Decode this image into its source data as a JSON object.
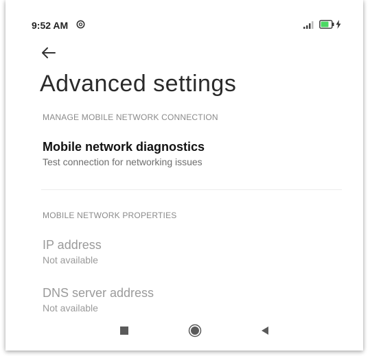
{
  "status_bar": {
    "time": "9:52 AM",
    "icons": [
      "circle-status-icon",
      "signal-icon",
      "battery-icon",
      "charging-bolt-icon"
    ]
  },
  "header": {
    "back_icon": "arrow-left-icon",
    "title": "Advanced settings"
  },
  "sections": [
    {
      "header": "MANAGE MOBILE NETWORK CONNECTION",
      "items": [
        {
          "title": "Mobile network diagnostics",
          "subtitle": "Test connection for networking issues",
          "enabled": true
        }
      ]
    },
    {
      "header": "MOBILE NETWORK PROPERTIES",
      "items": [
        {
          "title": "IP address",
          "subtitle": "Not available",
          "enabled": false
        },
        {
          "title": "DNS server address",
          "subtitle": "Not available",
          "enabled": false
        }
      ]
    }
  ],
  "nav_bar": {
    "icons": [
      "recents-square-icon",
      "home-circle-icon",
      "back-triangle-icon"
    ]
  },
  "colors": {
    "primary_text": "#111111",
    "secondary_text": "#6d6d6d",
    "disabled_text": "#9a9a9a",
    "section_header": "#8a8a8a",
    "divider": "#ececec",
    "battery_fill": "#4cd964"
  }
}
